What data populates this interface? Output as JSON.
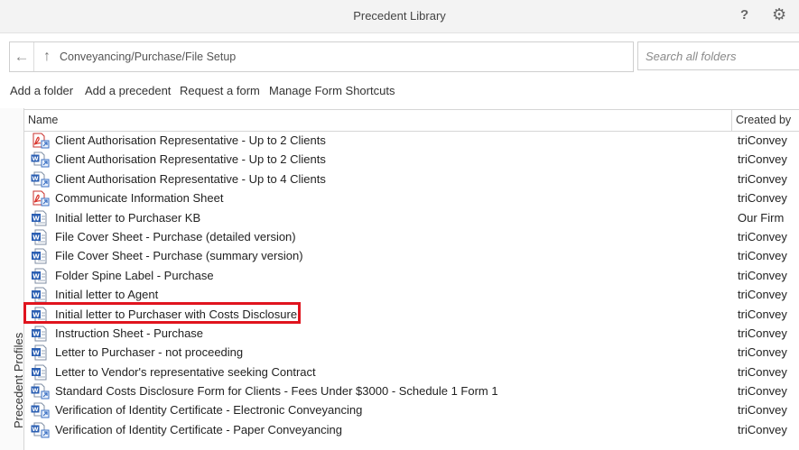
{
  "window": {
    "title": "Precedent Library"
  },
  "icons": {
    "help": "question-mark-icon",
    "settings": "gear-icon",
    "back": "arrow-left-icon",
    "up": "arrow-up-icon"
  },
  "path": {
    "text": "Conveyancing/Purchase/File Setup"
  },
  "search": {
    "placeholder": "Search all folders",
    "value": ""
  },
  "toolbar": {
    "add_folder": "Add a folder",
    "add_precedent": "Add a precedent",
    "request_form": "Request a form",
    "manage_shortcuts": "Manage Form Shortcuts"
  },
  "side_tab": {
    "label": "Precedent Profiles"
  },
  "table": {
    "headers": {
      "name": "Name",
      "created_by": "Created by"
    },
    "rows": [
      {
        "type": "pdf-shortcut",
        "name": "Client Authorisation Representative - Up to 2 Clients",
        "created_by": "triConvey"
      },
      {
        "type": "word-shortcut",
        "name": "Client Authorisation Representative - Up to 2 Clients",
        "created_by": "triConvey"
      },
      {
        "type": "word-shortcut",
        "name": "Client Authorisation Representative - Up to 4 Clients",
        "created_by": "triConvey"
      },
      {
        "type": "pdf-shortcut",
        "name": "Communicate Information Sheet",
        "created_by": "triConvey"
      },
      {
        "type": "word",
        "name": "Initial letter to Purchaser KB",
        "created_by": "Our Firm"
      },
      {
        "type": "word",
        "name": "File Cover Sheet - Purchase (detailed version)",
        "created_by": "triConvey"
      },
      {
        "type": "word",
        "name": "File Cover Sheet - Purchase (summary version)",
        "created_by": "triConvey"
      },
      {
        "type": "word",
        "name": "Folder Spine Label - Purchase",
        "created_by": "triConvey"
      },
      {
        "type": "word",
        "name": "Initial letter to Agent",
        "created_by": "triConvey"
      },
      {
        "type": "word",
        "name": "Initial letter to Purchaser with Costs Disclosure",
        "created_by": "triConvey"
      },
      {
        "type": "word",
        "name": "Instruction Sheet - Purchase",
        "created_by": "triConvey"
      },
      {
        "type": "word",
        "name": "Letter to Purchaser - not proceeding",
        "created_by": "triConvey"
      },
      {
        "type": "word",
        "name": "Letter to Vendor's representative seeking Contract",
        "created_by": "triConvey"
      },
      {
        "type": "word-shortcut",
        "name": "Standard Costs Disclosure Form for Clients - Fees Under $3000 - Schedule 1 Form 1",
        "created_by": "triConvey"
      },
      {
        "type": "word-shortcut",
        "name": "Verification of Identity Certificate - Electronic Conveyancing",
        "created_by": "triConvey"
      },
      {
        "type": "word-shortcut",
        "name": "Verification of Identity Certificate - Paper Conveyancing",
        "created_by": "triConvey"
      }
    ]
  },
  "highlight_color": "#e0141e"
}
